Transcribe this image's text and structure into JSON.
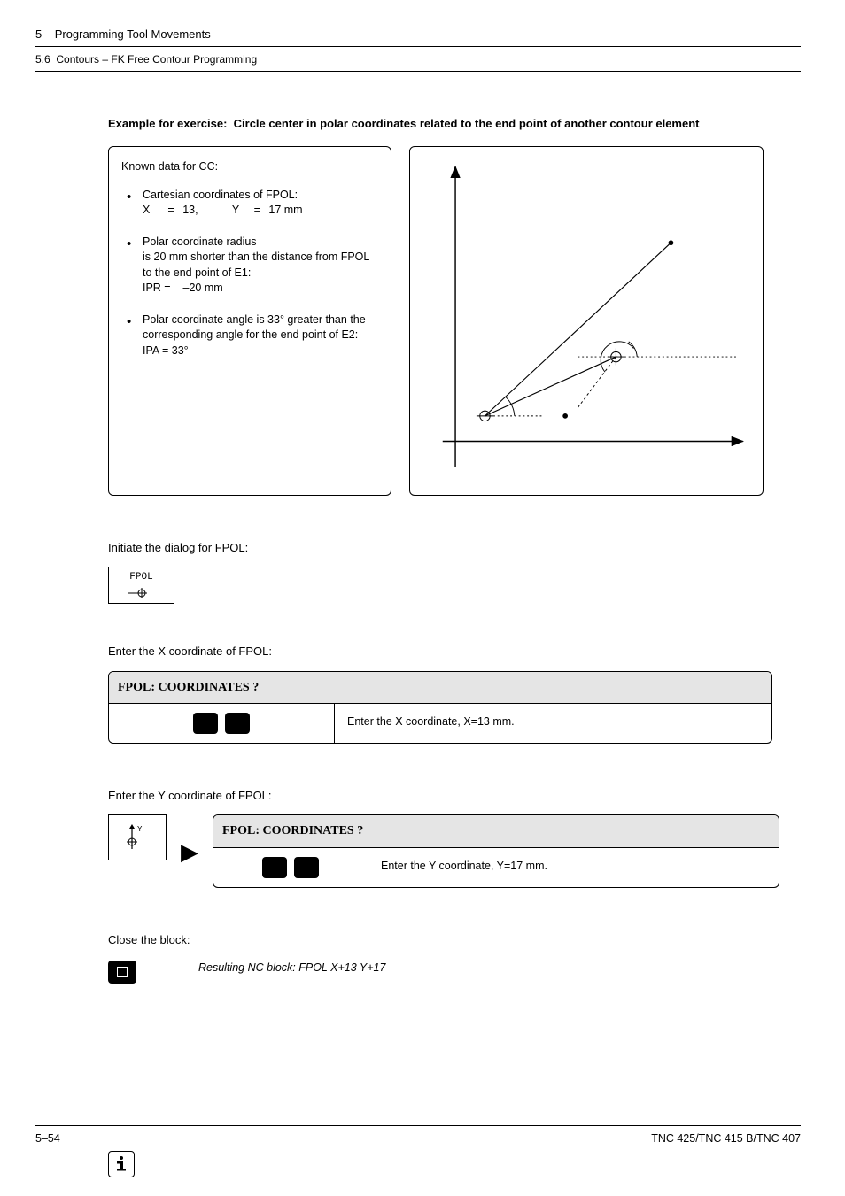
{
  "header": {
    "chapter_num": "5",
    "chapter_title": "Programming Tool Movements",
    "section_num": "5.6",
    "section_title": "Contours – FK Free Contour Programming"
  },
  "example": {
    "label": "Example for exercise:",
    "title": "Circle center in polar coordinates related to the end point of another contour element"
  },
  "known_data": {
    "title": "Known data for CC:",
    "bullet1": {
      "line1": "Cartesian coordinates of FPOL:",
      "x_label": "X",
      "x_eq": "=",
      "x_val": "13,",
      "y_label": "Y",
      "y_eq": "=",
      "y_val": "17 mm"
    },
    "bullet2": {
      "line1": "Polar coordinate radius",
      "line2": "is 20 mm shorter than the distance from FPOL to the end point of E1:",
      "ipr_label": "IPR =",
      "ipr_val": "–20 mm"
    },
    "bullet3": {
      "line1": "Polar coordinate angle is 33° greater than the corresponding angle for the end point of E2:",
      "ipa_label": "IPA = 33°"
    }
  },
  "steps": {
    "initiate_label": "Initiate the dialog for FPOL:",
    "fpol_key_text": "FPOL",
    "enter_x_label": "Enter the X coordinate of FPOL:",
    "prompt_title": "FPOL: COORDINATES ?",
    "enter_x_desc": "Enter the X coordinate, X=13 mm.",
    "enter_y_label": "Enter  the Y coordinate of FPOL:",
    "enter_y_desc": "Enter the Y coordinate, Y=17 mm.",
    "close_label": "Close the block:",
    "resulting": "Resulting NC block: FPOL X+13 Y+17"
  },
  "footer": {
    "page": "5–54",
    "doc": "TNC 425/TNC 415 B/TNC 407"
  }
}
